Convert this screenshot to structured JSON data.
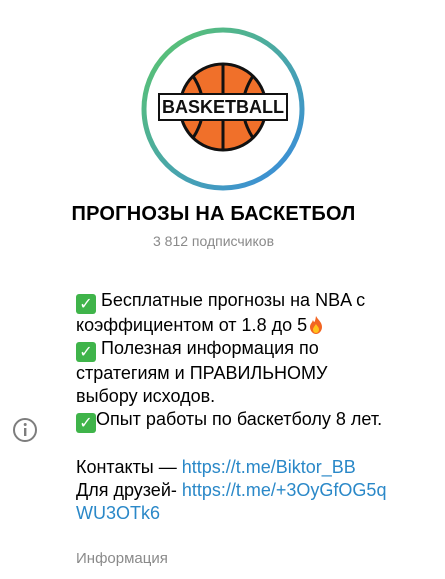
{
  "channel": {
    "title": "ПРОГНОЗЫ НА БАСКЕТБОЛ",
    "subscribers": "3 812 подписчиков",
    "avatar_text": "BASKETBALL"
  },
  "description": {
    "line1a": "Бесплатные прогнозы на NBA с",
    "line1b": "коэффициентом от 1.8 до 5",
    "line2a": "Полезная информация по",
    "line2b": "стратегиям и ПРАВИЛЬНОМУ",
    "line2c": "выбору исходов.",
    "line3": "Опыт работы по баскетболу 8 лет.",
    "contacts_label": "Контакты — ",
    "contacts_link": "https://t.me/Biktor_BB",
    "friends_label": "Для друзей- ",
    "friends_link_a": "https://t.me/+3OyGfOG5q",
    "friends_link_b": "WU3OTk6"
  },
  "info_label": "Информация",
  "icons": {
    "check": "check-mark-emoji",
    "fire": "fire-emoji",
    "info": "info-circle-icon"
  },
  "colors": {
    "link": "#2a88c8",
    "check": "#3fb44a",
    "ring_start": "#58c66a",
    "ring_end": "#3a8fe0"
  }
}
